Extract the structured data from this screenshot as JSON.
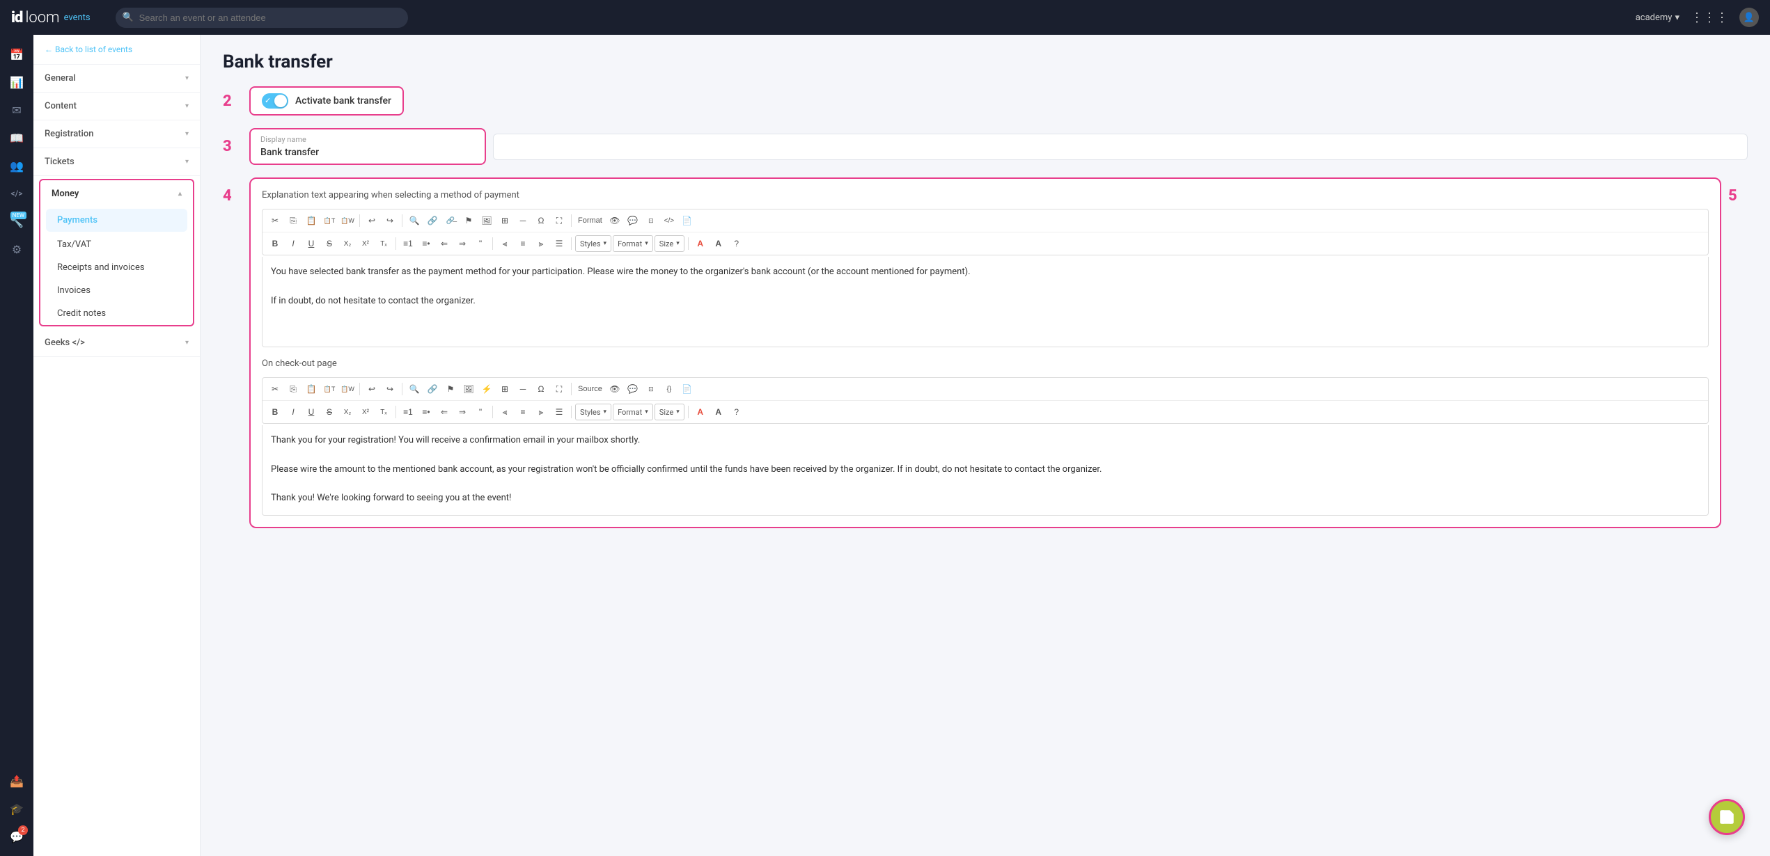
{
  "topbar": {
    "logo_id": "id",
    "logo_loom": "loom",
    "logo_events": "events",
    "search_placeholder": "Search an event or an attendee",
    "user": "academy",
    "grid_icon": "⋮⋮⋮",
    "avatar": "👤"
  },
  "nav": {
    "back_label": "← Back to list of events",
    "sections": [
      {
        "label": "General",
        "expanded": false
      },
      {
        "label": "Content",
        "expanded": false
      },
      {
        "label": "Registration",
        "expanded": false
      },
      {
        "label": "Tickets",
        "expanded": false
      }
    ],
    "money_section": {
      "label": "Money",
      "expanded": true,
      "items": [
        "Payments",
        "Tax/VAT",
        "Receipts and invoices",
        "Invoices",
        "Credit notes"
      ]
    },
    "geeks_section": {
      "label": "Geeks </>",
      "expanded": false
    }
  },
  "page": {
    "title": "Bank transfer",
    "step2_label": "2",
    "activate_label": "Activate bank transfer",
    "step3_label": "3",
    "display_name_label": "Display name",
    "display_name_value": "Bank transfer",
    "step4_label": "4",
    "explanation_title": "Explanation text appearing when selecting a method of payment",
    "explanation_text_line1": "You have selected bank transfer as the payment method for your participation. Please wire the money to the organizer's bank account (or the account mentioned for payment).",
    "explanation_text_line2": "If in doubt, do not hesitate to contact the organizer.",
    "checkout_title": "On check-out page",
    "checkout_text_line1": "Thank you for your registration! You will receive a confirmation email in your mailbox shortly.",
    "checkout_text_line2": "Please wire the amount to the mentioned bank account, as your registration won't be officially confirmed until the funds have been received by the organizer. If in doubt, do not hesitate to contact the organizer.",
    "checkout_text_line3": "Thank you! We're looking forward to seeing you at the event!",
    "step5_label": "5",
    "toolbar_styles": "Styles",
    "toolbar_format": "Format",
    "toolbar_size": "Size",
    "toolbar_format2": "Format",
    "toolbar_styles2": "Styles",
    "toolbar_size2": "Size"
  },
  "icons": {
    "calendar": "📅",
    "chart": "📊",
    "email": "✉",
    "book": "📖",
    "people": "👥",
    "code": "</>",
    "wrench_new": "🔧",
    "settings": "⚙",
    "send": "📤",
    "graduation": "🎓",
    "chat": "💬"
  }
}
